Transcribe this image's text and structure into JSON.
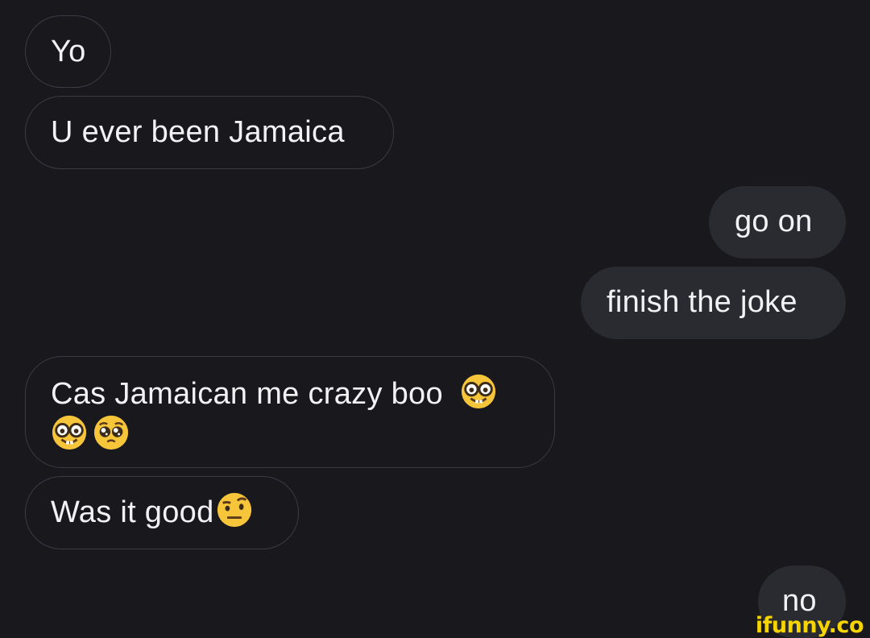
{
  "conversation": {
    "messages": [
      {
        "direction": "incoming",
        "text": "Yo"
      },
      {
        "direction": "incoming",
        "text": "U ever been Jamaica"
      },
      {
        "direction": "outgoing",
        "text": "go on"
      },
      {
        "direction": "outgoing",
        "text": "finish the joke"
      },
      {
        "direction": "incoming",
        "text": "Cas Jamaican me crazy boo",
        "emojis": [
          "nerd-face",
          "nerd-face",
          "pleading-face"
        ]
      },
      {
        "direction": "incoming",
        "text": "Was it good",
        "emojis": [
          "face-with-raised-eyebrow"
        ]
      },
      {
        "direction": "outgoing",
        "text": "no"
      }
    ]
  },
  "watermark": {
    "text": "ifunny.co",
    "color": "#f5d400"
  },
  "colors": {
    "background": "#18181d",
    "incoming_border": "#3b3b42",
    "outgoing_fill": "#2a2b30",
    "text": "#f2f2f4"
  }
}
